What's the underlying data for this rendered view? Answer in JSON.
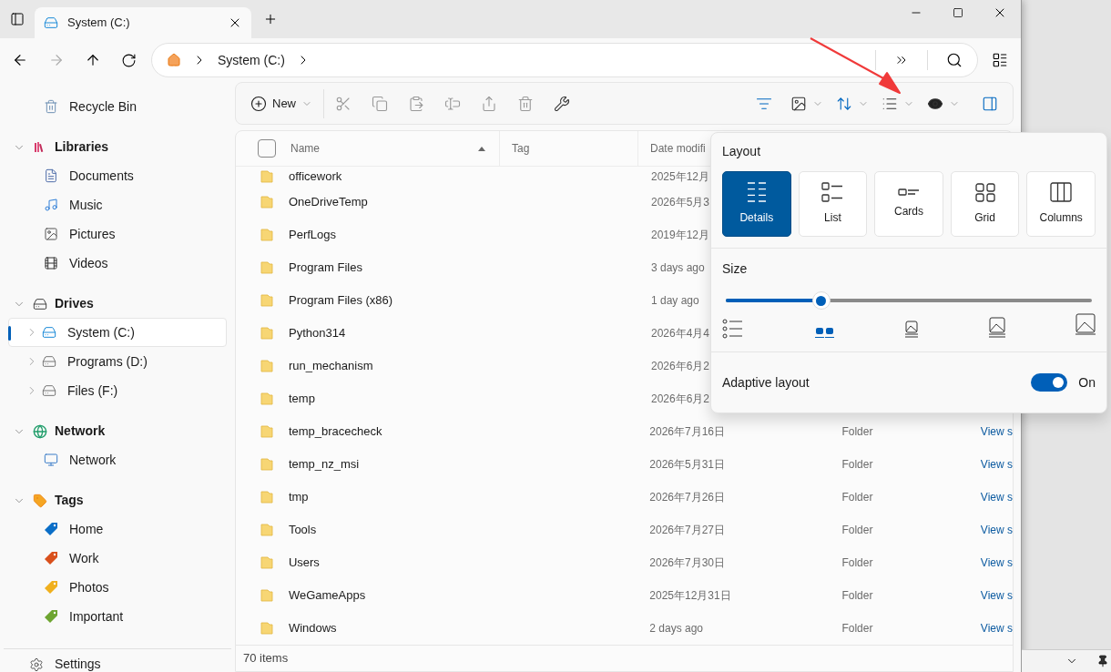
{
  "tabs": [
    {
      "title": "System (C:)",
      "selected": true
    }
  ],
  "address": {
    "crumbs": [
      "System (C:)"
    ]
  },
  "toolbar": {
    "new_label": "New"
  },
  "sidebar": {
    "top": [
      {
        "label": "Recycle Bin",
        "selected": false
      }
    ],
    "sections": [
      {
        "label": "Libraries",
        "expanded": true,
        "children": [
          {
            "label": "Documents",
            "selected": false
          },
          {
            "label": "Music",
            "selected": false
          },
          {
            "label": "Pictures",
            "selected": false
          },
          {
            "label": "Videos",
            "selected": false
          }
        ]
      },
      {
        "label": "Drives",
        "expanded": true,
        "children": [
          {
            "label": "System (C:)",
            "selected": true
          },
          {
            "label": "Programs (D:)",
            "selected": false
          },
          {
            "label": "Files (F:)",
            "selected": false
          }
        ]
      },
      {
        "label": "Network",
        "expanded": true,
        "children": [
          {
            "label": "Network",
            "selected": false
          }
        ]
      },
      {
        "label": "Tags",
        "expanded": true,
        "children": [
          {
            "label": "Home",
            "selected": false,
            "color": "#0a6ec7"
          },
          {
            "label": "Work",
            "selected": false,
            "color": "#d9501c"
          },
          {
            "label": "Photos",
            "selected": false,
            "color": "#f0b01e"
          },
          {
            "label": "Important",
            "selected": false,
            "color": "#6ea531"
          }
        ]
      }
    ],
    "settings": "Settings"
  },
  "table": {
    "select_all": {
      "checked": false
    },
    "columns": [
      {
        "label": "Name",
        "sorted": true
      },
      {
        "label": "Tag",
        "sorted": false
      },
      {
        "label": "Date modifi",
        "sorted": false
      }
    ],
    "rows": [
      {
        "name": "officework",
        "date": "2025年12月"
      },
      {
        "name": "OneDriveTemp",
        "date": "2026年5月3"
      },
      {
        "name": "PerfLogs",
        "date": "2019年12月"
      },
      {
        "name": "Program Files",
        "date": "3 days ago"
      },
      {
        "name": "Program Files (x86)",
        "date": "1 day ago"
      },
      {
        "name": "Python314",
        "date": "2026年4月4"
      },
      {
        "name": "run_mechanism",
        "date": "2026年6月2"
      },
      {
        "name": "temp",
        "date": "2026年6月2"
      },
      {
        "name": "temp_bracecheck",
        "date": "2026年7月16日",
        "type": "Folder",
        "link": "View s"
      },
      {
        "name": "temp_nz_msi",
        "date": "2026年5月31日",
        "type": "Folder",
        "link": "View s"
      },
      {
        "name": "tmp",
        "date": "2026年7月26日",
        "type": "Folder",
        "link": "View s"
      },
      {
        "name": "Tools",
        "date": "2026年7月27日",
        "type": "Folder",
        "link": "View s"
      },
      {
        "name": "Users",
        "date": "2026年7月30日",
        "type": "Folder",
        "link": "View s"
      },
      {
        "name": "WeGameApps",
        "date": "2025年12月31日",
        "type": "Folder",
        "link": "View s"
      },
      {
        "name": "Windows",
        "date": "2 days ago",
        "type": "Folder",
        "link": "View s"
      }
    ]
  },
  "status_bar": "70 items",
  "layout_menu": {
    "title": "Layout",
    "options": [
      {
        "label": "Details",
        "selected": true
      },
      {
        "label": "List",
        "selected": false
      },
      {
        "label": "Cards",
        "selected": false
      },
      {
        "label": "Grid",
        "selected": false
      },
      {
        "label": "Columns",
        "selected": false
      }
    ],
    "size": {
      "label": "Size",
      "level": 0.26
    },
    "adaptive": {
      "label": "Adaptive layout",
      "on": true,
      "state_text": "On"
    }
  }
}
